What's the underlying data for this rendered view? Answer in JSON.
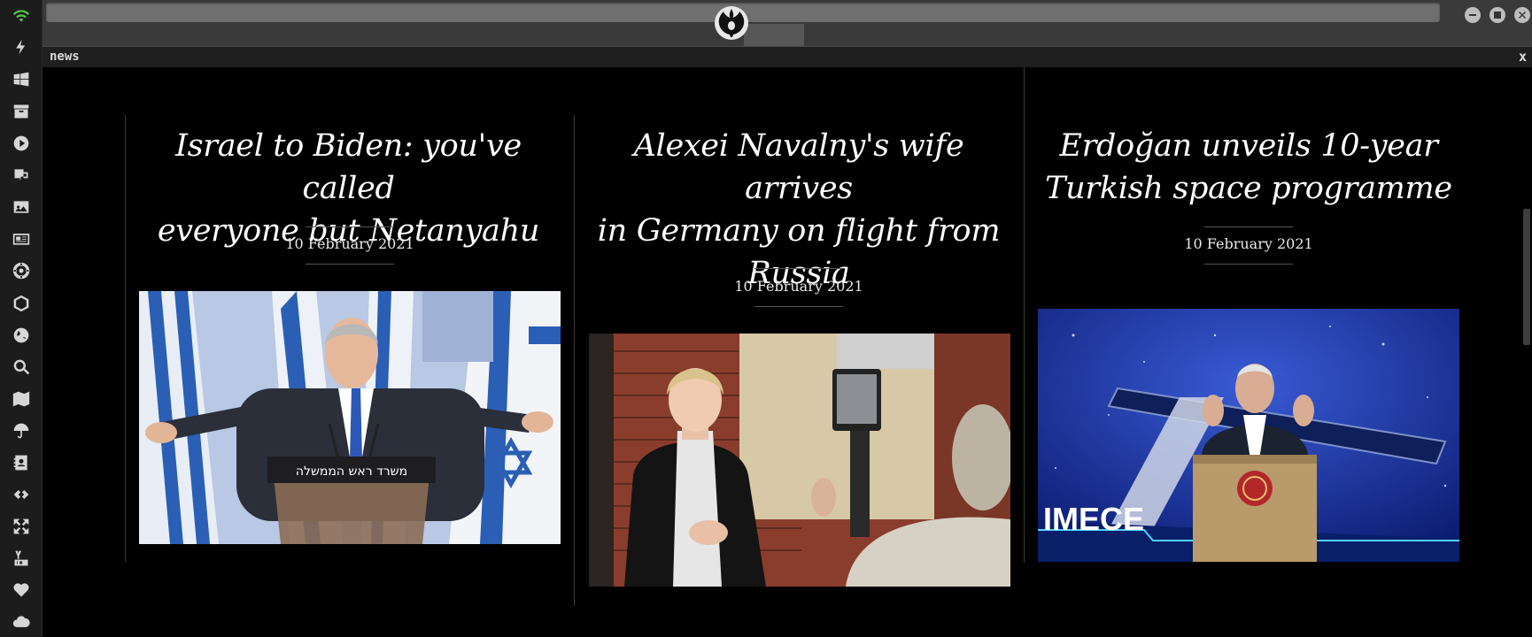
{
  "window": {
    "tab_label": "news",
    "close_label": "x"
  },
  "sidebar": {
    "icons": [
      "wifi-icon",
      "bolt-icon",
      "windows-icon",
      "archive-icon",
      "play-icon",
      "translate-icon",
      "image-icon",
      "newspaper-icon",
      "empire-icon",
      "hex-icon",
      "globe-icon",
      "search-icon",
      "map-icon",
      "umbrella-icon",
      "contact-icon",
      "link-icon",
      "expand-icon",
      "youtube-icon",
      "heart-icon",
      "cloud-icon"
    ]
  },
  "articles": [
    {
      "headline_lines": [
        "Israel to Biden: you've called",
        "everyone but Netanyahu"
      ],
      "date": "10 February 2021",
      "image": "netanyahu-photo"
    },
    {
      "headline_lines": [
        "Alexei Navalny's wife arrives",
        "in Germany on flight from",
        "Russia"
      ],
      "date": "10 February 2021",
      "image": "navalnaya-photo"
    },
    {
      "headline_lines": [
        "Erdoğan unveils 10-year",
        "Turkish space programme"
      ],
      "date": "10 February 2021",
      "image": "erdogan-photo"
    }
  ],
  "photo_text": {
    "podium_sign": "משרד ראש הממשלה",
    "banner": "IMECE"
  },
  "colors": {
    "background": "#000000",
    "sidebar": "#1c1c1c",
    "wifi": "#56c24a",
    "topbar": "#3a3a3a"
  }
}
